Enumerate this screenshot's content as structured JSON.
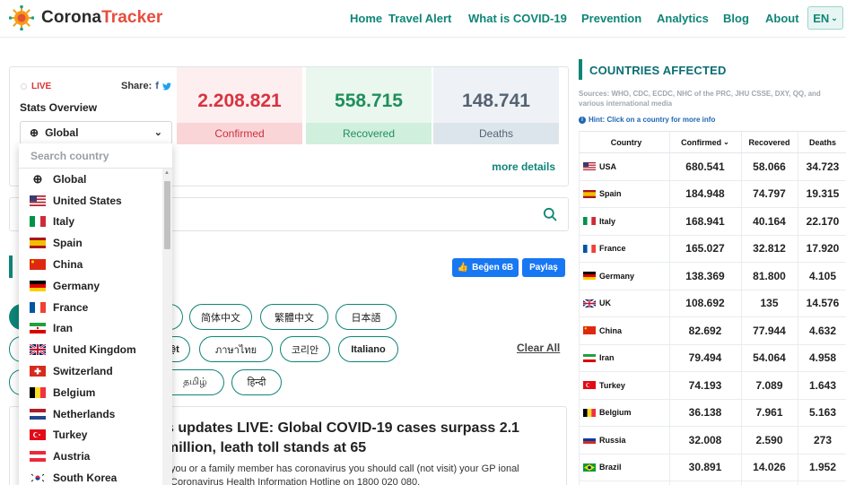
{
  "nav": {
    "logo_part1": "Corona",
    "logo_part2": "Tracker",
    "items": [
      "Home",
      "Travel Alert",
      "What is COVID-19",
      "Prevention",
      "Analytics",
      "Blog",
      "About"
    ],
    "lang": "EN"
  },
  "stats": {
    "live_label": "LIVE",
    "share_label": "Share:",
    "overview_title": "Stats Overview",
    "region_selected": "Global",
    "confirmed_value": "2.208.821",
    "confirmed_label": "Confirmed",
    "recovered_value": "558.715",
    "recovered_label": "Recovered",
    "deaths_value": "148.741",
    "deaths_label": "Deaths",
    "more_details": "more details"
  },
  "dropdown": {
    "search_placeholder": "Search country",
    "items": [
      {
        "label": "Global",
        "icon": "globe-icon"
      },
      {
        "label": "United States",
        "icon": "flag-us"
      },
      {
        "label": "Italy",
        "icon": "flag-italy"
      },
      {
        "label": "Spain",
        "icon": "flag-spain"
      },
      {
        "label": "China",
        "icon": "flag-china"
      },
      {
        "label": "Germany",
        "icon": "flag-germany"
      },
      {
        "label": "France",
        "icon": "flag-france"
      },
      {
        "label": "Iran",
        "icon": "flag-iran"
      },
      {
        "label": "United Kingdom",
        "icon": "flag-uk"
      },
      {
        "label": "Switzerland",
        "icon": "flag-switzerland"
      },
      {
        "label": "Belgium",
        "icon": "flag-belgium"
      },
      {
        "label": "Netherlands",
        "icon": "flag-netherlands"
      },
      {
        "label": "Turkey",
        "icon": "flag-turkey"
      },
      {
        "label": "Austria",
        "icon": "flag-austria"
      },
      {
        "label": "South Korea",
        "icon": "flag-south-korea"
      }
    ]
  },
  "social": {
    "like_label": "Beğen 6B",
    "share_label": "Paylaş"
  },
  "languages": {
    "row1": [
      "简体中文",
      "繁體中文",
      "日本語"
    ],
    "row2": [
      "ệt",
      "ภาษาไทย",
      "코리안",
      "Italiano"
    ],
    "row3": [
      "தமிழ்",
      "हिन्दी"
    ],
    "clear_all": "Clear All"
  },
  "news": {
    "title": "s updates LIVE: Global COVID-19 cases surpass 2.1 million, leath toll stands at 65",
    "body": "you or a family member has coronavirus you should call (not visit) your GP ional Coronavirus Health Information Hotline on 1800 020 080."
  },
  "countries": {
    "title": "COUNTRIES AFFECTED",
    "sources": "Sources: WHO, CDC, ECDC, NHC of the PRC, JHU CSSE, DXY, QQ, and various international media",
    "hint": "Hint: Click on a country for more info",
    "headers": {
      "country": "Country",
      "confirmed": "Confirmed",
      "recovered": "Recovered",
      "deaths": "Deaths"
    },
    "rows": [
      {
        "country": "USA",
        "confirmed": "680.541",
        "recovered": "58.066",
        "deaths": "34.723",
        "flag": "flag-us"
      },
      {
        "country": "Spain",
        "confirmed": "184.948",
        "recovered": "74.797",
        "deaths": "19.315",
        "flag": "flag-spain"
      },
      {
        "country": "Italy",
        "confirmed": "168.941",
        "recovered": "40.164",
        "deaths": "22.170",
        "flag": "flag-italy"
      },
      {
        "country": "France",
        "confirmed": "165.027",
        "recovered": "32.812",
        "deaths": "17.920",
        "flag": "flag-france"
      },
      {
        "country": "Germany",
        "confirmed": "138.369",
        "recovered": "81.800",
        "deaths": "4.105",
        "flag": "flag-germany"
      },
      {
        "country": "UK",
        "confirmed": "108.692",
        "recovered": "135",
        "deaths": "14.576",
        "flag": "flag-uk"
      },
      {
        "country": "China",
        "confirmed": "82.692",
        "recovered": "77.944",
        "deaths": "4.632",
        "flag": "flag-china"
      },
      {
        "country": "Iran",
        "confirmed": "79.494",
        "recovered": "54.064",
        "deaths": "4.958",
        "flag": "flag-iran"
      },
      {
        "country": "Turkey",
        "confirmed": "74.193",
        "recovered": "7.089",
        "deaths": "1.643",
        "flag": "flag-turkey"
      },
      {
        "country": "Belgium",
        "confirmed": "36.138",
        "recovered": "7.961",
        "deaths": "5.163",
        "flag": "flag-belgium"
      },
      {
        "country": "Russia",
        "confirmed": "32.008",
        "recovered": "2.590",
        "deaths": "273",
        "flag": "flag-russia"
      },
      {
        "country": "Brazil",
        "confirmed": "30.891",
        "recovered": "14.026",
        "deaths": "1.952",
        "flag": "flag-brazil"
      }
    ]
  }
}
